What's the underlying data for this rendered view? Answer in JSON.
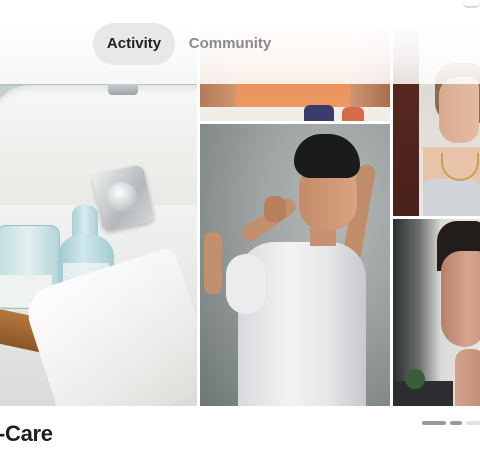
{
  "tabs": [
    {
      "label": "Activity",
      "selected": true
    },
    {
      "label": "Community",
      "selected": false
    }
  ],
  "section": {
    "title": "-Care"
  },
  "carousel": {
    "pages": 3,
    "current": 1
  },
  "colors": {
    "tab_selected_bg": "#e8e8e8",
    "tab_selected_text": "#222222",
    "tab_unselected_text": "#8a8a8a",
    "title_text": "#1e1e1e"
  }
}
